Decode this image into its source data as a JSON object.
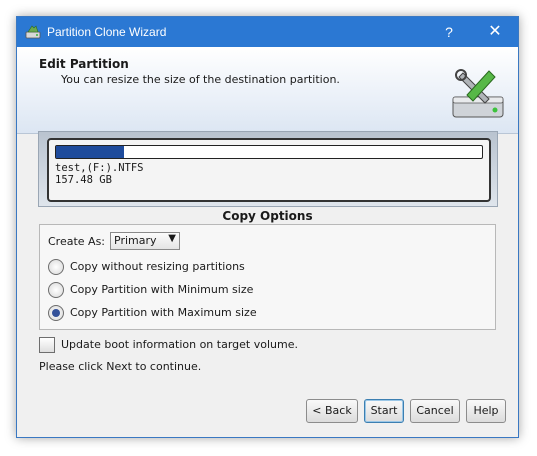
{
  "window": {
    "title": "Partition Clone Wizard",
    "help_glyph": "?",
    "close_glyph": "✕"
  },
  "header": {
    "title": "Edit Partition",
    "subtitle": "You can resize the size of the destination partition.",
    "icon": "disk-tools-icon"
  },
  "disk": {
    "label_line1": "test,(F:).NTFS",
    "label_line2": "157.48 GB",
    "used_fraction": 0.16
  },
  "copy_options": {
    "title": "Copy Options",
    "create_as_label": "Create As:",
    "create_as_value": "Primary",
    "options": [
      {
        "label": "Copy without resizing partitions",
        "checked": false
      },
      {
        "label": "Copy Partition with Minimum size",
        "checked": false
      },
      {
        "label": "Copy Partition with Maximum size",
        "checked": true
      }
    ]
  },
  "boot_option": {
    "label": "Update boot information on target volume.",
    "checked": false
  },
  "instruction": "Please click Next to continue.",
  "buttons": {
    "back": "< Back",
    "start": "Start",
    "cancel": "Cancel",
    "help": "Help"
  },
  "colors": {
    "titlebar": "#2b78d3",
    "disk_fill": "#1e4b9c"
  }
}
